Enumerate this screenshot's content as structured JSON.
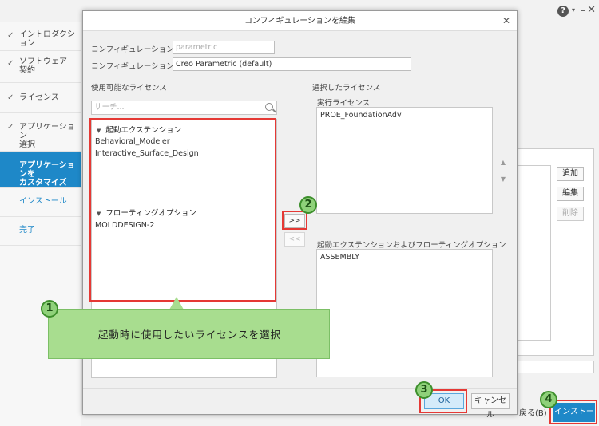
{
  "outer": {
    "help_label": "?",
    "chevron_label": "▾",
    "minimize_label": "–",
    "close_label": "✕",
    "steps": [
      {
        "label": "イントロダクション",
        "check": "✓"
      },
      {
        "label": "ソフトウェア\n契約",
        "check": "✓"
      },
      {
        "label": "ライセンス",
        "check": "✓"
      },
      {
        "label": "アプリケーション\n選択",
        "check": "✓"
      },
      {
        "label": "アプリケーションを\nカスタマイズ",
        "check": ""
      },
      {
        "label": "インストール",
        "check": ""
      },
      {
        "label": "完了",
        "check": ""
      }
    ],
    "add_label": "追加",
    "edit_label": "編集",
    "delete_label": "削除",
    "back_label": "戻る(B)",
    "install_label": "インストール"
  },
  "dialog": {
    "title": "コンフィギュレーションを編集",
    "close_label": "✕",
    "config_name_label": "コンフィギュレーション名:",
    "config_name_value": "parametric",
    "config_desc_label": "コンフィギュレーションの説明:",
    "config_desc_value": "Creo Parametric (default)",
    "available_heading": "使用可能なライセンス",
    "search_placeholder": "サーチ...",
    "groups": [
      {
        "label": "起動エクステンション",
        "items": [
          "Behavioral_Modeler",
          "Interactive_Surface_Design"
        ]
      },
      {
        "label": "フローティングオプション",
        "items": [
          "MOLDDESIGN-2"
        ]
      }
    ],
    "add_button": ">>",
    "remove_button": "<<",
    "selected_heading": "選択したライセンス",
    "runtime_label": "実行ライセンス",
    "runtime_items": [
      "PROE_FoundationAdv"
    ],
    "ext_label": "起動エクステンションおよびフローティングオプション",
    "ext_items": [
      "ASSEMBLY"
    ],
    "up_label": "▲",
    "down_label": "▼",
    "ok_label": "OK",
    "cancel_label": "キャンセル"
  },
  "annotations": {
    "badge1": "1",
    "badge2": "2",
    "badge3": "3",
    "badge4": "4",
    "callout": "起動時に使用したいライセンスを選択",
    "color_badge": "#8fd17a",
    "color_highlight": "#e53935"
  }
}
